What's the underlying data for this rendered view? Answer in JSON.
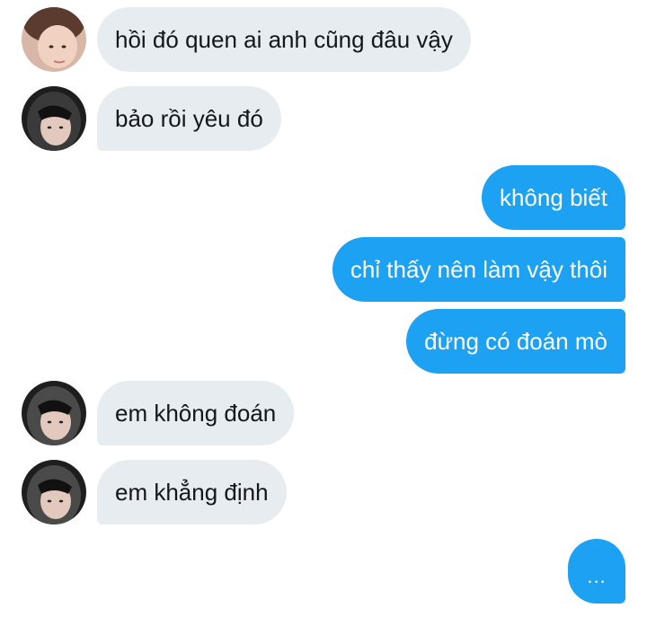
{
  "colors": {
    "incoming_bubble": "#e6ecf0",
    "outgoing_bubble": "#1da1f2",
    "incoming_text": "#14171a",
    "outgoing_text": "#ffffff"
  },
  "messages": [
    {
      "side": "incoming",
      "avatar": "avatar-light-hair",
      "text": "hồi đó quen ai anh cũng đâu vậy"
    },
    {
      "side": "incoming",
      "avatar": "avatar-hood",
      "text": "bảo rồi yêu đó"
    },
    {
      "side": "outgoing",
      "text": "không biết"
    },
    {
      "side": "outgoing",
      "text": "chỉ thấy nên làm vậy thôi"
    },
    {
      "side": "outgoing",
      "text": "đừng có đoán mò"
    },
    {
      "side": "incoming",
      "avatar": "avatar-hood",
      "text": "em không đoán"
    },
    {
      "side": "incoming",
      "avatar": "avatar-hood",
      "text": "em khẳng định"
    }
  ],
  "typing_indicator": "..."
}
